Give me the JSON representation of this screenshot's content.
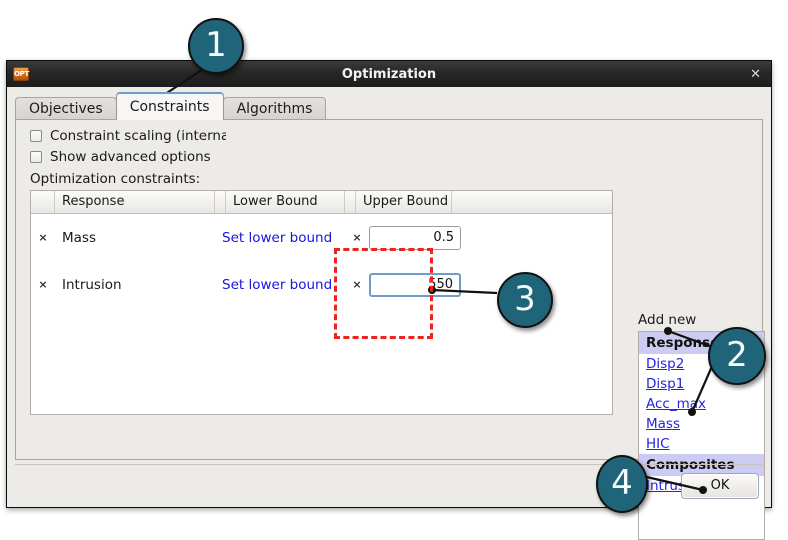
{
  "window": {
    "title": "Optimization",
    "icon": "OPT",
    "icon_name": "optimization-app-icon",
    "close_label": "✕"
  },
  "tabs": [
    {
      "label": "Objectives",
      "active": false
    },
    {
      "label": "Constraints",
      "active": true
    },
    {
      "label": "Algorithms",
      "active": false
    }
  ],
  "options": {
    "constraint_scaling": "Constraint scaling (interna",
    "show_advanced": "Show advanced options"
  },
  "section": {
    "constraints_label": "Optimization constraints:"
  },
  "table": {
    "headers": {
      "blank1": "",
      "response": "Response",
      "blank2": "",
      "lower_bound": "Lower Bound",
      "blank3": "",
      "upper_bound": "Upper Bound",
      "blank4": ""
    },
    "rows": [
      {
        "delete": "×",
        "response": "Mass",
        "lower_bound_link": "Set lower bound",
        "upper_delete": "×",
        "upper_bound_value": "0.5",
        "upper_focused": false
      },
      {
        "delete": "×",
        "response": "Intrusion",
        "lower_bound_link": "Set lower bound",
        "upper_delete": "×",
        "upper_bound_value": "550",
        "upper_focused": true
      }
    ]
  },
  "add_new": {
    "label": "Add new",
    "groups": [
      {
        "header": "Responses",
        "items": [
          "Disp2",
          "Disp1",
          "Acc_max",
          "Mass",
          "HIC"
        ]
      },
      {
        "header": "Composites",
        "items": [
          "Intrusion"
        ]
      }
    ]
  },
  "buttons": {
    "ok": "OK"
  },
  "annotations": {
    "colors": {
      "badge": "#1f6478",
      "highlight": "#ef2222",
      "link": "#2424dd"
    },
    "badges": [
      {
        "number": "1",
        "target": "constraints-tab"
      },
      {
        "number": "2",
        "target": "add-new-items"
      },
      {
        "number": "3",
        "target": "upper-bound-fields"
      },
      {
        "number": "4",
        "target": "ok-button"
      }
    ]
  }
}
